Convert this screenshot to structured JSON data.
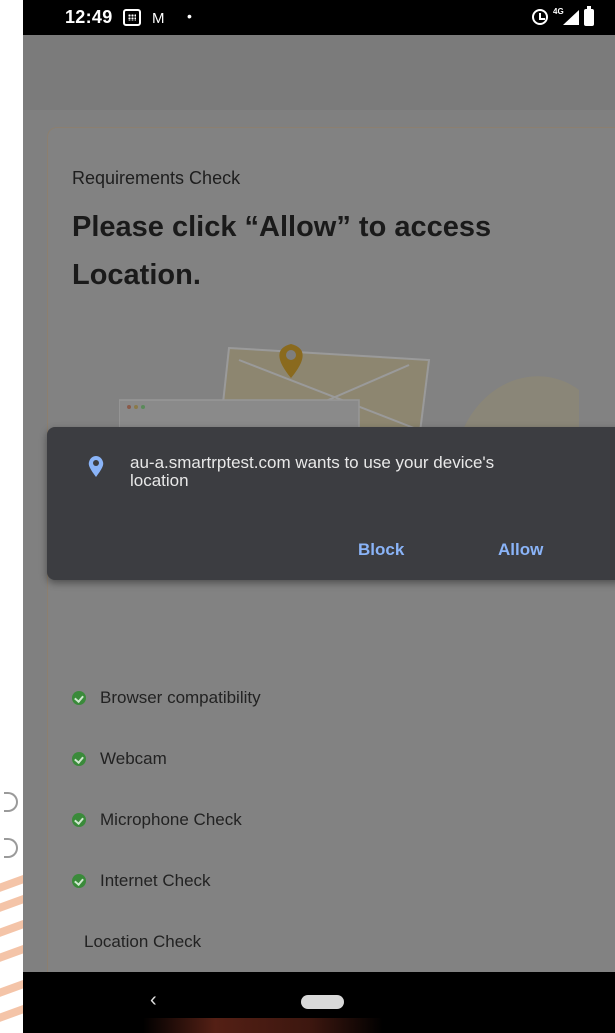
{
  "status_bar": {
    "time": "12:49",
    "network_label": "4G",
    "icons": [
      "calendar-icon",
      "gmail-icon",
      "notification-dot-icon",
      "alarm-icon",
      "signal-icon",
      "battery-icon"
    ]
  },
  "page": {
    "section_label": "Requirements Check",
    "headline": "Please click “Allow” to access Location."
  },
  "permission_dialog": {
    "message": "au-a.smartrptest.com wants to use your device's location",
    "block_label": "Block",
    "allow_label": "Allow",
    "accent_color": "#8ab4f8"
  },
  "checklist": {
    "items": [
      {
        "label": "Browser compatibility",
        "status": "passed"
      },
      {
        "label": "Webcam",
        "status": "passed"
      },
      {
        "label": "Microphone Check",
        "status": "passed"
      },
      {
        "label": "Internet Check",
        "status": "passed"
      },
      {
        "label": "Location Check",
        "status": "pending"
      }
    ],
    "passed_color": "#3a8a3a"
  },
  "nav_bar": {
    "back_symbol": "‹"
  }
}
